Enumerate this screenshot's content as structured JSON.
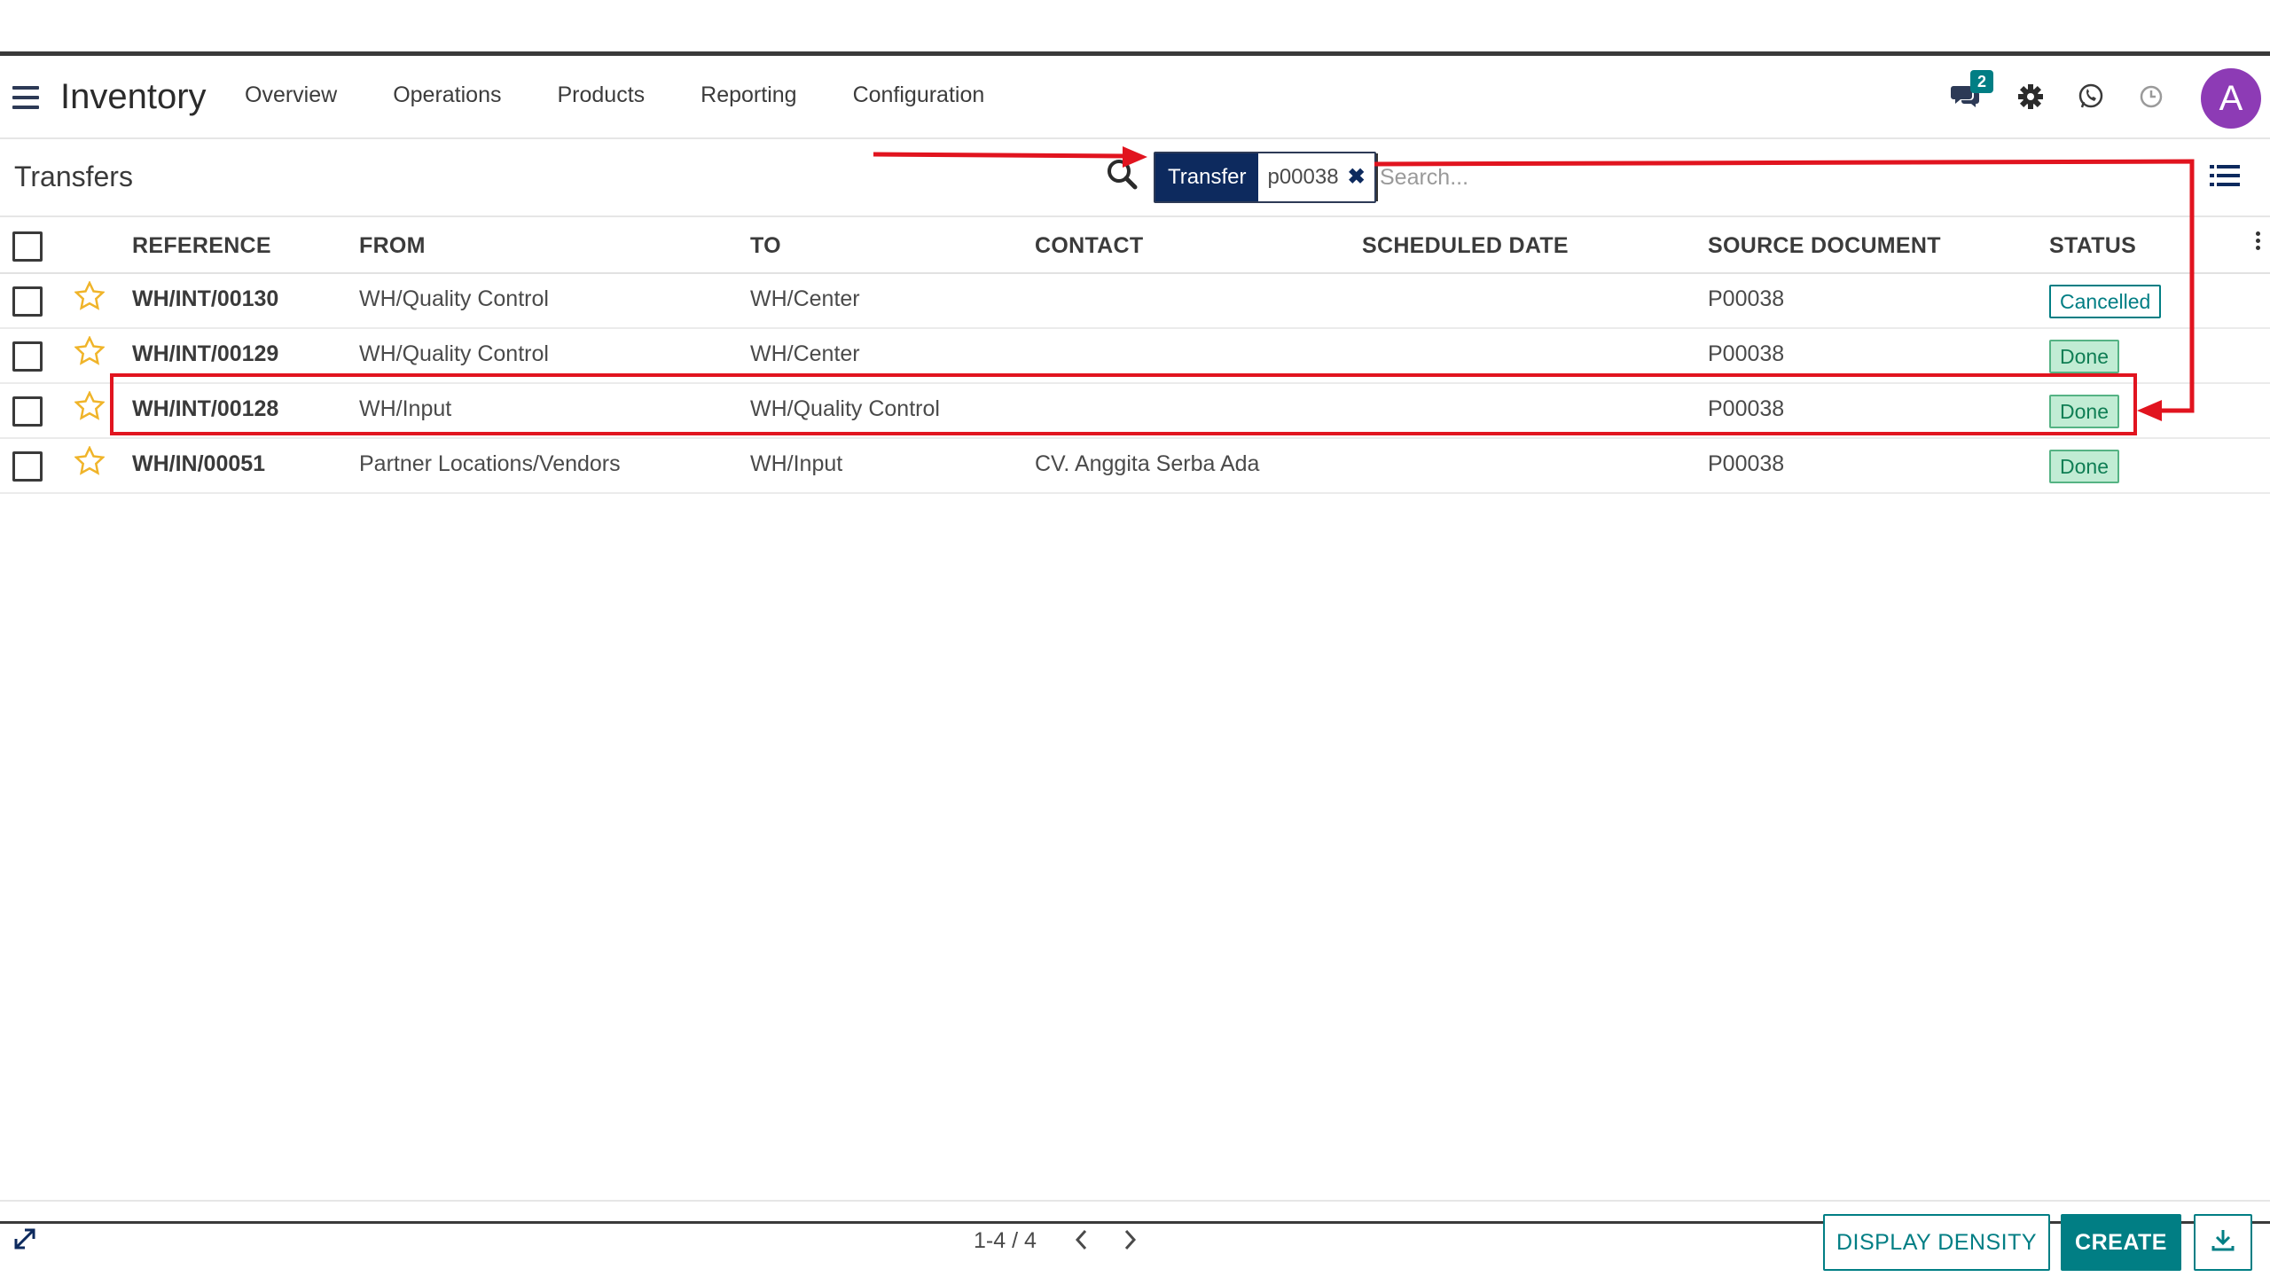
{
  "navbar": {
    "app_name": "Inventory",
    "menu": [
      "Overview",
      "Operations",
      "Products",
      "Reporting",
      "Configuration"
    ],
    "messages_badge": "2",
    "avatar_letter": "A",
    "accent_color": "#017e84",
    "avatar_color": "#8d3bb5"
  },
  "control_panel": {
    "title": "Transfers",
    "facet_label": "Transfer",
    "facet_value": "p00038",
    "search_placeholder": "Search..."
  },
  "table": {
    "columns": [
      "REFERENCE",
      "FROM",
      "TO",
      "CONTACT",
      "SCHEDULED DATE",
      "SOURCE DOCUMENT",
      "STATUS"
    ],
    "rows": [
      {
        "reference": "WH/INT/00130",
        "from": "WH/Quality Control",
        "to": "WH/Center",
        "contact": "",
        "scheduled_date": "",
        "source_document": "P00038",
        "status": "Cancelled"
      },
      {
        "reference": "WH/INT/00129",
        "from": "WH/Quality Control",
        "to": "WH/Center",
        "contact": "",
        "scheduled_date": "",
        "source_document": "P00038",
        "status": "Done"
      },
      {
        "reference": "WH/INT/00128",
        "from": "WH/Input",
        "to": "WH/Quality Control",
        "contact": "",
        "scheduled_date": "",
        "source_document": "P00038",
        "status": "Done"
      },
      {
        "reference": "WH/IN/00051",
        "from": "Partner Locations/Vendors",
        "to": "WH/Input",
        "contact": "CV. Anggita Serba Ada",
        "scheduled_date": "",
        "source_document": "P00038",
        "status": "Done"
      }
    ]
  },
  "footer": {
    "pager": "1-4 / 4",
    "display_density_label": "DISPLAY DENSITY",
    "create_label": "CREATE"
  },
  "annotation_color": "#e1141f"
}
